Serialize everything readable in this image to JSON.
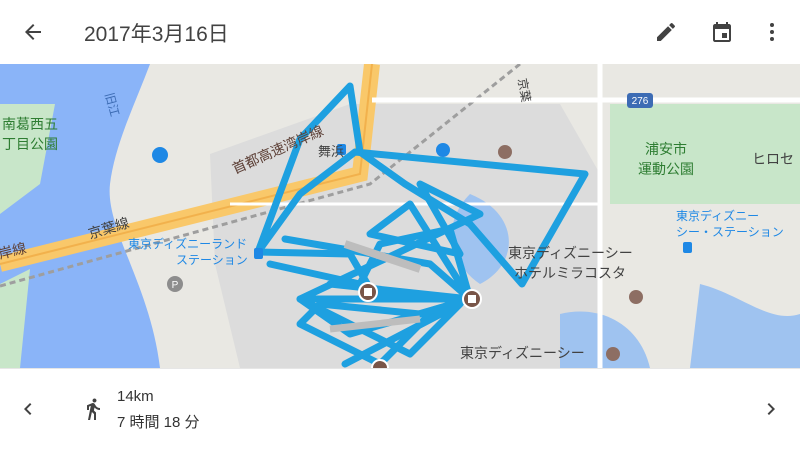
{
  "header": {
    "title": "2017年3月16日"
  },
  "map": {
    "route_color": "#1ea0e0",
    "labels": {
      "minamikasai": "南葛西五",
      "park1": "丁目公園",
      "old_edo": "旧江",
      "shuto": "首都高速湾岸線",
      "keiyo": "京葉線",
      "keiyo_top": "京葉",
      "wangan": "岸線",
      "maihama": "舞浜",
      "station_land_1": "東京ディズニーランド",
      "station_land_2": "ステーション",
      "urayasu_park_1": "浦安市",
      "urayasu_park_2": "運動公園",
      "hiro": "ヒロセ",
      "station_sea_1": "東京ディズニー",
      "station_sea_2": "シー・ステーション",
      "sea": "東京ディズニーシー",
      "hotel_1": "東京ディズニーシー",
      "hotel_2": "ホテルミラコスタ",
      "route_shield": "276"
    }
  },
  "summary": {
    "distance": "14km",
    "duration": "7 時間 18 分"
  }
}
